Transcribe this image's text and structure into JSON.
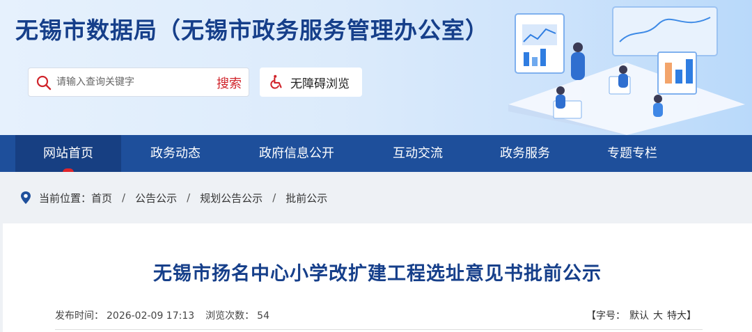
{
  "header": {
    "site_title": "无锡市数据局（无锡市政务服务管理办公室）",
    "search": {
      "placeholder": "请输入查询关键字",
      "button_label": "搜索"
    },
    "accessibility_label": "无障碍浏览"
  },
  "nav": {
    "items": [
      "网站首页",
      "政务动态",
      "政府信息公开",
      "互动交流",
      "政务服务",
      "专题专栏"
    ],
    "active_index": 0
  },
  "breadcrumb": {
    "prefix": "当前位置：",
    "items": [
      "首页",
      "公告公示",
      "规划公告公示",
      "批前公示"
    ],
    "separator": "/"
  },
  "article": {
    "title": "无锡市扬名中心小学改扩建工程选址意见书批前公示",
    "publish_label": "发布时间：",
    "publish_time": "2026-02-09 17:13",
    "views_label": "浏览次数：",
    "views": "54",
    "font_size": {
      "open": "【",
      "label": "字号：",
      "default": "默认",
      "large": "大",
      "xlarge": "特大",
      "close": "】"
    }
  },
  "colors": {
    "brand_blue": "#163f8a",
    "nav_blue": "#1e4f9b",
    "accent_red": "#d0242b"
  },
  "icons": [
    "search-icon",
    "wheelchair-icon",
    "location-pin-icon"
  ]
}
